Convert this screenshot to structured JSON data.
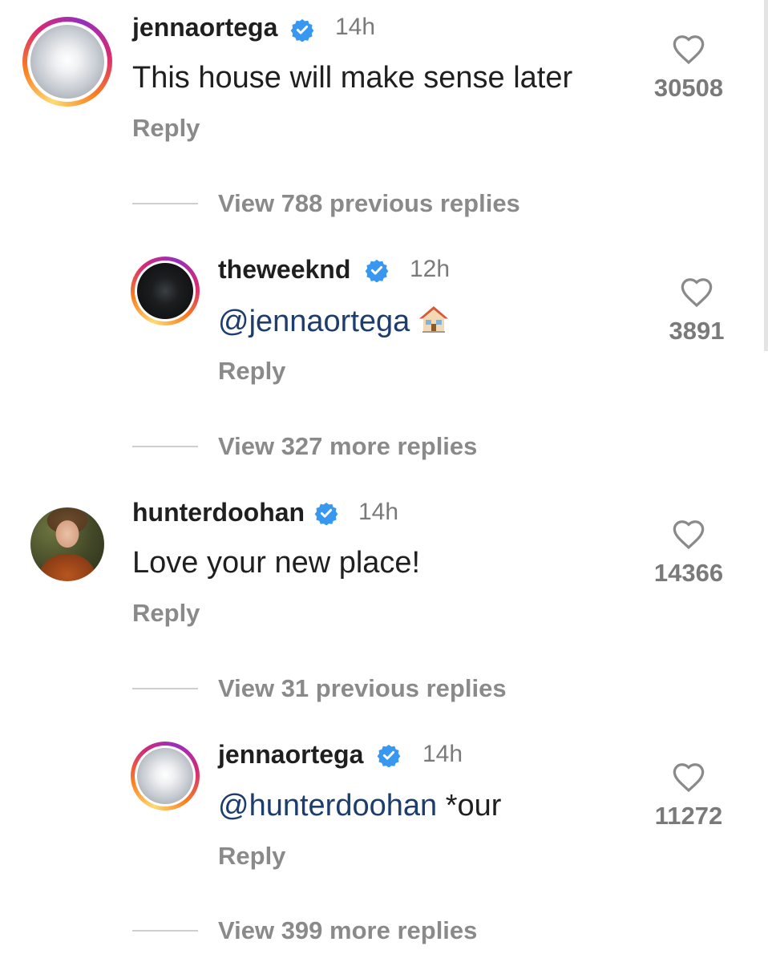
{
  "comments": [
    {
      "username": "jennaortega",
      "time": "14h",
      "text": "This house will make sense later",
      "reply_label": "Reply",
      "likes": "30508",
      "icons": {
        "verified": "verified-badge-icon",
        "like": "heart-icon"
      }
    },
    {
      "username": "theweeknd",
      "time": "12h",
      "mention": "@jennaortega",
      "emoji": "house-icon",
      "reply_label": "Reply",
      "likes": "3891"
    },
    {
      "username": "hunterdoohan",
      "time": "14h",
      "text": "Love your new place!",
      "reply_label": "Reply",
      "likes": "14366"
    },
    {
      "username": "jennaortega",
      "time": "14h",
      "mention": "@hunterdoohan",
      "text_after": "*our",
      "reply_label": "Reply",
      "likes": "11272"
    }
  ],
  "view_replies": [
    "View 788 previous replies",
    "View 327 more replies",
    "View 31 previous replies",
    "View 399 more replies"
  ],
  "colors": {
    "verified": "#3897f0",
    "mention": "#1c3d6e",
    "muted": "#8a8a8a"
  }
}
